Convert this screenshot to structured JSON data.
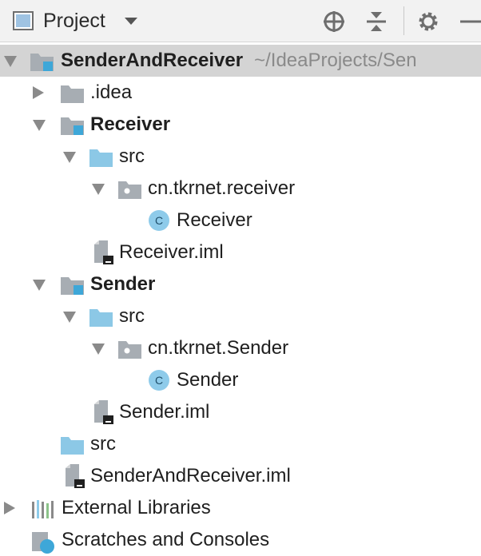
{
  "toolbar": {
    "title": "Project",
    "icons": [
      "view-mode-icon",
      "locate-icon",
      "collapse-all-icon",
      "gear-icon",
      "minimize-icon"
    ]
  },
  "tree": [
    {
      "label": "SenderAndReceiver",
      "path": "~/IdeaProjects/Sen",
      "icon": "module-folder-icon",
      "expanded": true,
      "bold": true,
      "selected": true
    },
    {
      "label": ".idea",
      "icon": "folder-icon",
      "expanded": false
    },
    {
      "label": "Receiver",
      "icon": "module-folder-icon",
      "expanded": true,
      "bold": true
    },
    {
      "label": "src",
      "icon": "source-folder-icon",
      "expanded": true
    },
    {
      "label": "cn.tkrnet.receiver",
      "icon": "package-icon",
      "expanded": true
    },
    {
      "label": "Receiver",
      "icon": "class-icon"
    },
    {
      "label": "Receiver.iml",
      "icon": "iml-file-icon"
    },
    {
      "label": "Sender",
      "icon": "module-folder-icon",
      "expanded": true,
      "bold": true
    },
    {
      "label": "src",
      "icon": "source-folder-icon",
      "expanded": true
    },
    {
      "label": "cn.tkrnet.Sender",
      "icon": "package-icon",
      "expanded": true
    },
    {
      "label": "Sender",
      "icon": "class-icon"
    },
    {
      "label": "Sender.iml",
      "icon": "iml-file-icon"
    },
    {
      "label": "src",
      "icon": "source-folder-icon"
    },
    {
      "label": "SenderAndReceiver.iml",
      "icon": "iml-file-icon"
    },
    {
      "label": "External Libraries",
      "icon": "libraries-icon",
      "expanded": false
    },
    {
      "label": "Scratches and Consoles",
      "icon": "scratches-icon"
    }
  ],
  "colors": {
    "toolbar_bg": "#f2f2f2",
    "selection_bg": "#d4d4d4",
    "folder_gray": "#a7adb3",
    "source_blue": "#8cc8e6",
    "module_accent": "#3ea7d8",
    "class_circle": "#8ecbea"
  }
}
